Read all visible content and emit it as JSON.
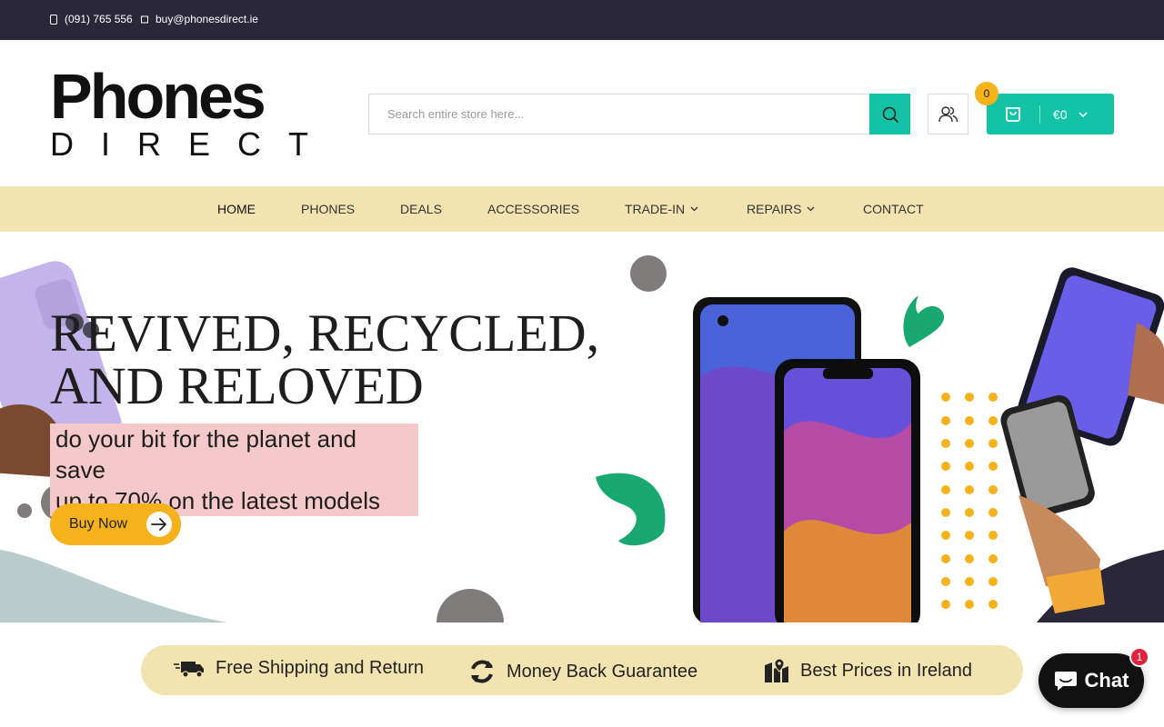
{
  "topbar": {
    "phone": "(091) 765 556",
    "email": "buy@phonesdirect.ie",
    "phone_icon": "phone-icon",
    "email_icon": "envelope-icon"
  },
  "header": {
    "logo_top": "Phones",
    "logo_bottom": "DIRECT",
    "search_placeholder": "Search entire store here...",
    "search_icon": "search-icon",
    "account_icon": "user-icon",
    "cart_count": "0",
    "cart_total": "€0",
    "cart_icon": "shopping-bag-icon"
  },
  "nav": {
    "items": [
      {
        "label": "HOME",
        "dropdown": false
      },
      {
        "label": "PHONES",
        "dropdown": false
      },
      {
        "label": "DEALS",
        "dropdown": false
      },
      {
        "label": "ACCESSORIES",
        "dropdown": false
      },
      {
        "label": "TRADE-IN",
        "dropdown": true
      },
      {
        "label": "REPAIRS",
        "dropdown": true
      },
      {
        "label": "CONTACT",
        "dropdown": false
      }
    ]
  },
  "hero": {
    "title_line1": "REVIVED, RECYCLED,",
    "title_line2": "AND RELOVED",
    "subtitle_line1": "do your bit for the planet and save",
    "subtitle_line2": "up to 70% on the latest models",
    "button_label": "Buy Now"
  },
  "features": [
    {
      "label": "Free Shipping and Return",
      "icon": "truck-icon"
    },
    {
      "label": "Money Back Guarantee",
      "icon": "refresh-icon"
    },
    {
      "label": "Best Prices in Ireland",
      "icon": "map-pin-icon"
    }
  ],
  "chat": {
    "label": "Chat",
    "badge": "1",
    "icon": "chat-bubble-icon"
  },
  "colors": {
    "topbar": "#2a2838",
    "accent": "#14c3a5",
    "nav_bg": "#f2e4b0",
    "button": "#f6b21b",
    "highlight": "#f5c8cb"
  }
}
